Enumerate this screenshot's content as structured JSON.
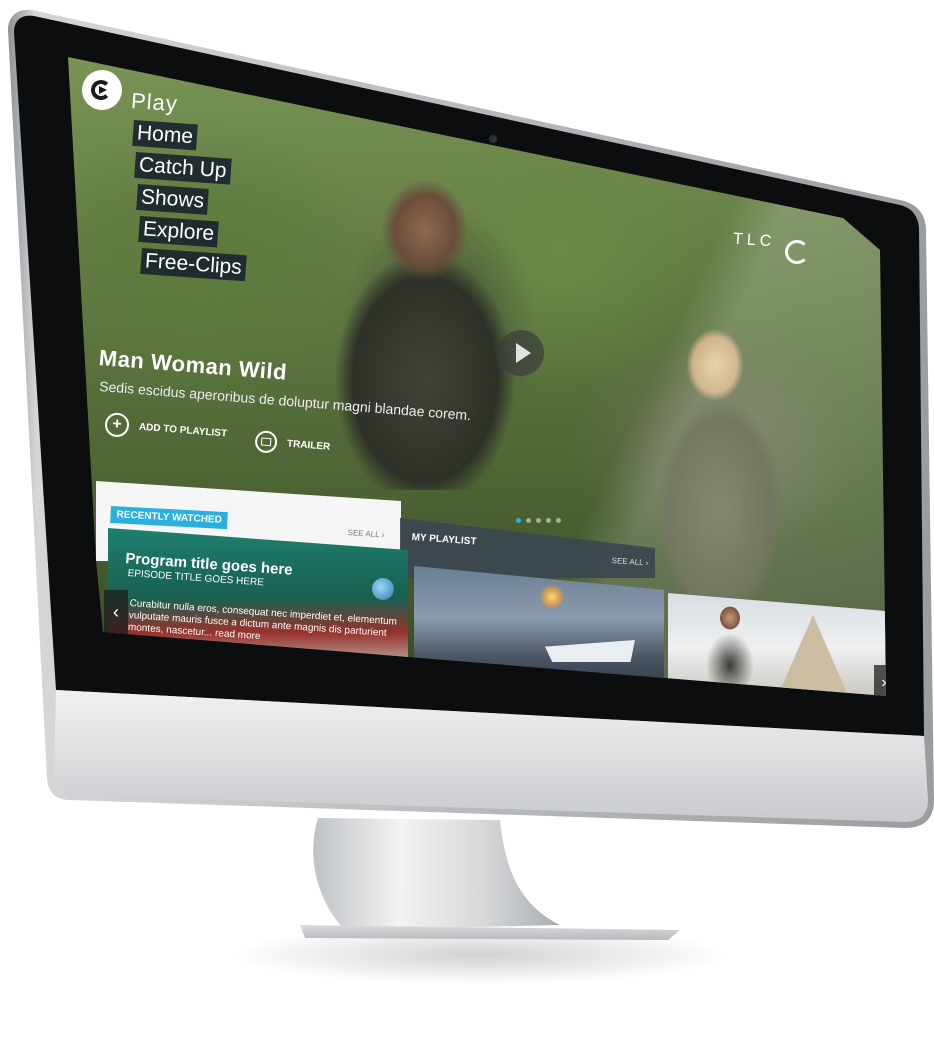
{
  "nav": {
    "brand": "Play",
    "items": [
      "Home",
      "Catch Up",
      "Shows",
      "Explore",
      "Free-Clips"
    ]
  },
  "hero": {
    "title": "Man Woman Wild",
    "description": "Sedis escidus aperoribus de doluptur magni blandae corem.",
    "add_to_playlist": "ADD TO PLAYLIST",
    "trailer": "TRAILER",
    "channel_logo": "TLC",
    "slide_count": 5,
    "active_slide": 1
  },
  "recently_watched": {
    "label": "RECENTLY WATCHED",
    "see_all": "SEE ALL",
    "item": {
      "title": "Program title goes here",
      "episode": "EPISODE TITLE GOES HERE",
      "description": "Curabitur nulla eros, consequat nec imperdiet et, elementum vulputate mauris fusce a dictum ante magnis dis parturient montes, nascetur... read more"
    }
  },
  "playlist": {
    "label": "MY PLAYLIST",
    "see_all": "SEE ALL"
  },
  "icons": {
    "plus": "+",
    "chevron_right": "›",
    "chevron_left": "‹"
  },
  "colors": {
    "accent": "#2ab0e0",
    "nav_bg": "#141e2d",
    "playlist_bg": "#3c4650"
  }
}
